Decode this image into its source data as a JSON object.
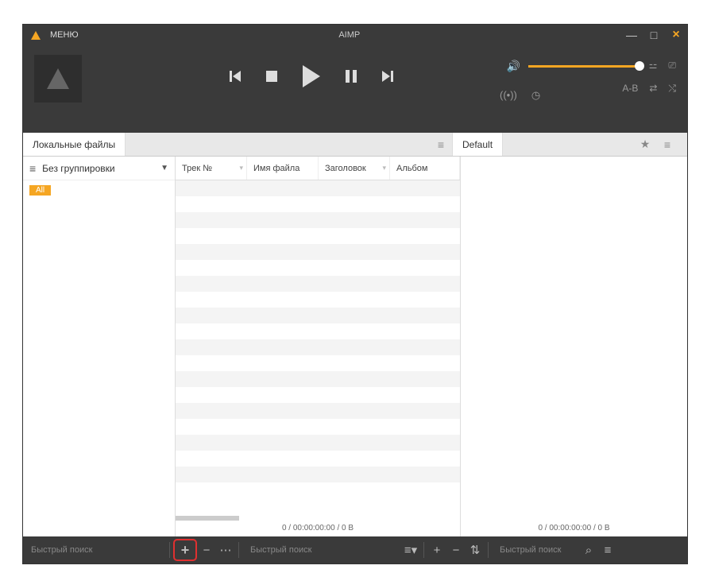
{
  "titlebar": {
    "menu": "МЕНЮ",
    "title": "AIMP"
  },
  "tabs": {
    "left": "Локальные файлы",
    "right": "Default"
  },
  "grouping": {
    "label": "Без группировки",
    "all": "All"
  },
  "columns": {
    "track": "Трек №",
    "filename": "Имя файла",
    "title": "Заголовок",
    "album": "Альбом"
  },
  "status": {
    "left": "0 / 00:00:00:00 / 0 B",
    "right": "0 / 00:00:00:00 / 0 B"
  },
  "search": {
    "placeholder": "Быстрый поиск"
  },
  "extra": {
    "ab": "A-B"
  },
  "colors": {
    "accent": "#f5a623"
  }
}
